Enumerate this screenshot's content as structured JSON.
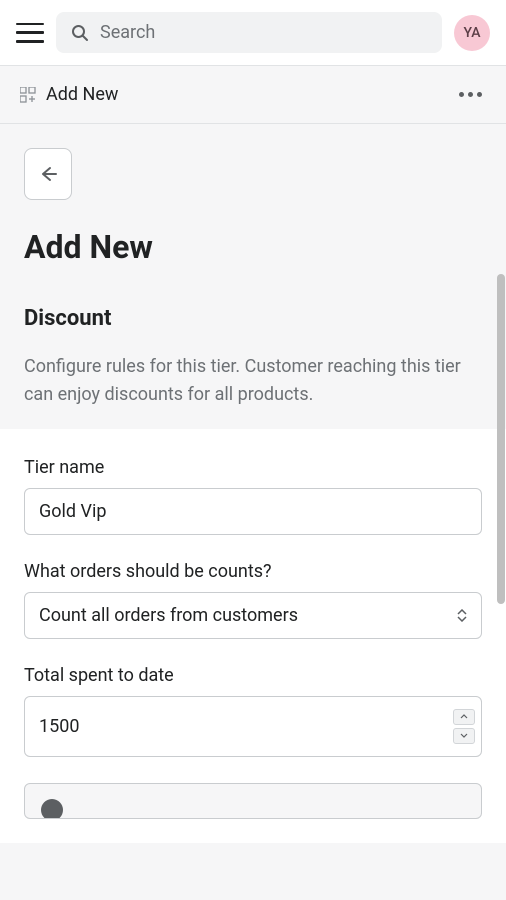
{
  "topBar": {
    "searchPlaceholder": "Search",
    "avatarInitials": "YA"
  },
  "subHeader": {
    "title": "Add New"
  },
  "page": {
    "title": "Add New",
    "sectionTitle": "Discount",
    "sectionDesc": "Configure rules for this tier. Customer reaching this tier can enjoy discounts for all products."
  },
  "fields": {
    "tierName": {
      "label": "Tier name",
      "value": "Gold Vip"
    },
    "orderCount": {
      "label": "What orders should be counts?",
      "value": "Count all orders from customers"
    },
    "totalSpent": {
      "label": "Total spent to date",
      "value": "1500"
    }
  }
}
